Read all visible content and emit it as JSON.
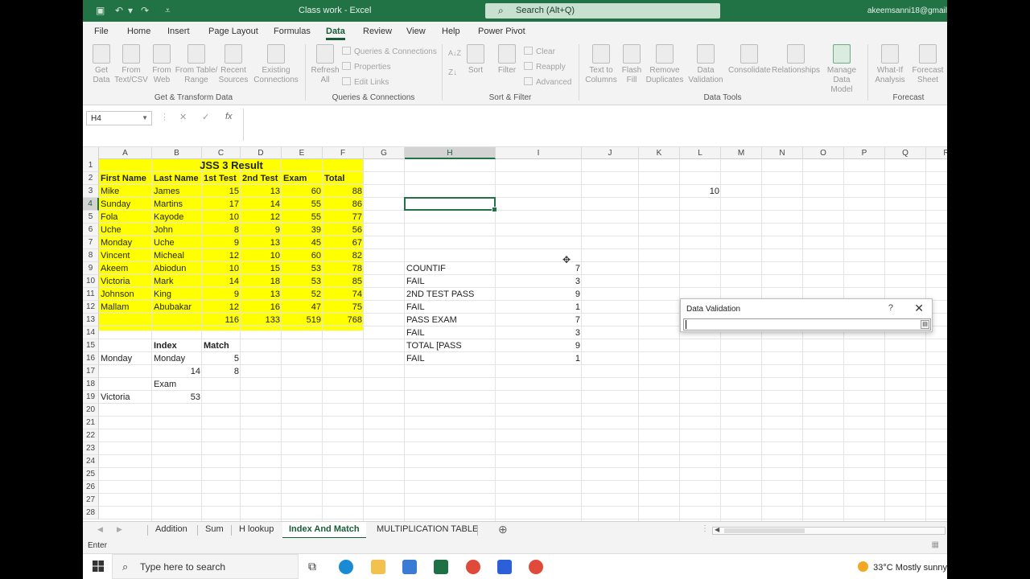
{
  "titlebar": {
    "doc_title": "Class work  -  Excel",
    "search_placeholder": "Search (Alt+Q)",
    "account": "akeemsanni18@gmail"
  },
  "ribbon_tabs": [
    {
      "label": "File"
    },
    {
      "label": "Home"
    },
    {
      "label": "Insert"
    },
    {
      "label": "Page Layout"
    },
    {
      "label": "Formulas"
    },
    {
      "label": "Data"
    },
    {
      "label": "Review"
    },
    {
      "label": "View"
    },
    {
      "label": "Help"
    },
    {
      "label": "Power Pivot"
    }
  ],
  "ribbon": {
    "get_data_l1": "Get",
    "get_data_l2": "Data",
    "from_text_l1": "From",
    "from_text_l2": "Text/CSV",
    "from_web_l1": "From",
    "from_web_l2": "Web",
    "from_table_l1": "From Table/",
    "from_table_l2": "Range",
    "recent_l1": "Recent",
    "recent_l2": "Sources",
    "existing_l1": "Existing",
    "existing_l2": "Connections",
    "group_get": "Get & Transform Data",
    "refresh_l1": "Refresh",
    "refresh_l2": "All",
    "queries_connections": "Queries & Connections",
    "properties": "Properties",
    "edit_links": "Edit Links",
    "group_queries": "Queries & Connections",
    "sort_az": "A↓Z",
    "sort": "Sort",
    "filter": "Filter",
    "clear": "Clear",
    "reapply": "Reapply",
    "advanced": "Advanced",
    "group_sort": "Sort & Filter",
    "text_to_columns_l1": "Text to",
    "text_to_columns_l2": "Columns",
    "flash_fill_l1": "Flash",
    "flash_fill_l2": "Fill",
    "remove_dup_l1": "Remove",
    "remove_dup_l2": "Duplicates",
    "data_validation_l1": "Data",
    "data_validation_l2": "Validation",
    "consolidate": "Consolidate",
    "relationships": "Relationships",
    "manage_model_l1": "Manage",
    "manage_model_l2": "Data Model",
    "group_tools": "Data Tools",
    "whatif_l1": "What-If",
    "whatif_l2": "Analysis",
    "forecast_l1": "Forecast",
    "forecast_l2": "Sheet",
    "group_forecast": "Forecast"
  },
  "formula_bar": {
    "name_box": "H4",
    "fx": "fx",
    "cancel": "✕",
    "enter": "✓"
  },
  "columns": [
    "A",
    "B",
    "C",
    "D",
    "E",
    "F",
    "G",
    "H",
    "I",
    "J",
    "K",
    "L",
    "M",
    "N",
    "O",
    "P",
    "Q",
    "R"
  ],
  "rows": [
    "1",
    "2",
    "3",
    "4",
    "5",
    "6",
    "7",
    "8",
    "9",
    "10",
    "11",
    "12",
    "13",
    "14",
    "15",
    "16",
    "17",
    "18",
    "19",
    "20",
    "21",
    "22",
    "23",
    "24",
    "25",
    "26",
    "27",
    "28"
  ],
  "sheet": {
    "title": "JSS 3 Result",
    "headers": [
      "First Name",
      "Last Name",
      "1st Test",
      "2nd Test",
      "Exam",
      "Total"
    ],
    "students": [
      [
        "Mike",
        "James",
        "15",
        "13",
        "60",
        "88"
      ],
      [
        "Sunday",
        "Martins",
        "17",
        "14",
        "55",
        "86"
      ],
      [
        "Fola",
        "Kayode",
        "10",
        "12",
        "55",
        "77"
      ],
      [
        "Uche",
        "John",
        "8",
        "9",
        "39",
        "56"
      ],
      [
        "Monday",
        "Uche",
        "9",
        "13",
        "45",
        "67"
      ],
      [
        "Vincent",
        "Micheal",
        "12",
        "10",
        "60",
        "82"
      ],
      [
        "Akeem",
        "Abiodun",
        "10",
        "15",
        "53",
        "78"
      ],
      [
        "Victoria",
        "Mark",
        "14",
        "18",
        "53",
        "85"
      ],
      [
        "Johnson",
        "King",
        "9",
        "13",
        "52",
        "74"
      ],
      [
        "Mallam",
        "Abubakar",
        "12",
        "16",
        "47",
        "75"
      ]
    ],
    "totals": [
      "116",
      "133",
      "519",
      "768"
    ],
    "b15": "Index",
    "c15": "Match",
    "a16": "Monday",
    "b16": "Monday",
    "c16": "5",
    "b17": "14",
    "c17": "8",
    "b18": "Exam",
    "a19": "Victoria",
    "b19": "53",
    "l3": "10",
    "h_labels": [
      "COUNTIF",
      "FAIL",
      "2ND TEST PASS",
      "FAIL",
      "PASS EXAM",
      "FAIL",
      "TOTAL [PASS",
      "FAIL"
    ],
    "i_values": [
      "7",
      "3",
      "9",
      "1",
      "7",
      "3",
      "9",
      "1"
    ]
  },
  "data_validation": {
    "title": "Data Validation",
    "help": "?",
    "close": "✕"
  },
  "sheet_tabs": [
    {
      "label": "Addition"
    },
    {
      "label": "Sum"
    },
    {
      "label": "H lookup"
    },
    {
      "label": "Index And Match"
    },
    {
      "label": "MULTIPLICATION TABLE"
    }
  ],
  "add_sheet": "⊕",
  "status": {
    "mode": "Enter"
  },
  "taskbar": {
    "search_placeholder": "Type here to search",
    "weather": "33°C  Mostly sunny"
  }
}
